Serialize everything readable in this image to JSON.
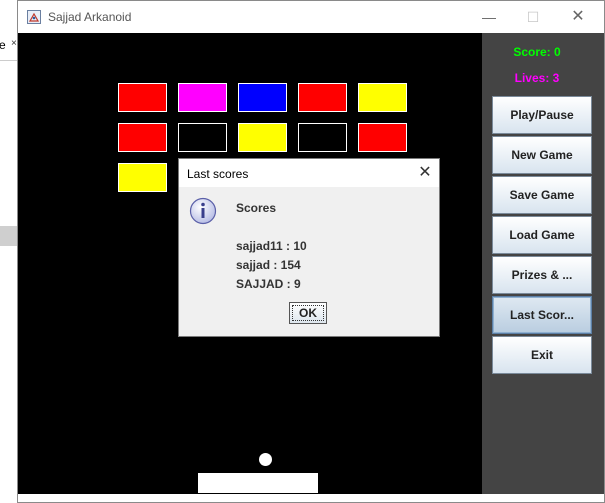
{
  "background_app": {
    "tab_fragment": "e",
    "tab_close": "×"
  },
  "window": {
    "title": "Sajjad Arkanoid",
    "controls": {
      "minimize": "—",
      "maximize": "☐",
      "close": "✕"
    }
  },
  "game": {
    "bricks": [
      {
        "row": 0,
        "col": 0,
        "color": "#ff0000"
      },
      {
        "row": 0,
        "col": 1,
        "color": "#ff00ff"
      },
      {
        "row": 0,
        "col": 2,
        "color": "#0000ff"
      },
      {
        "row": 0,
        "col": 3,
        "color": "#ff0000"
      },
      {
        "row": 0,
        "col": 4,
        "color": "#ffff00"
      },
      {
        "row": 1,
        "col": 0,
        "color": "#ff0000"
      },
      {
        "row": 1,
        "col": 1,
        "color": "#000000"
      },
      {
        "row": 1,
        "col": 2,
        "color": "#ffff00"
      },
      {
        "row": 1,
        "col": 3,
        "color": "#000000"
      },
      {
        "row": 1,
        "col": 4,
        "color": "#ff0000"
      },
      {
        "row": 2,
        "col": 0,
        "color": "#ffff00"
      }
    ]
  },
  "sidebar": {
    "score": "Score: 0",
    "lives": "Lives: 3",
    "buttons": {
      "play_pause": "Play/Pause",
      "new_game": "New Game",
      "save_game": "Save Game",
      "load_game": "Load Game",
      "prizes": "Prizes & ...",
      "last_scores": "Last Scor...",
      "exit": "Exit"
    }
  },
  "dialog": {
    "title": "Last scores",
    "close": "✕",
    "heading": "Scores",
    "scores": [
      "sajjad11 : 10",
      "sajjad : 154",
      "SAJJAD : 9"
    ],
    "ok": "OK"
  }
}
